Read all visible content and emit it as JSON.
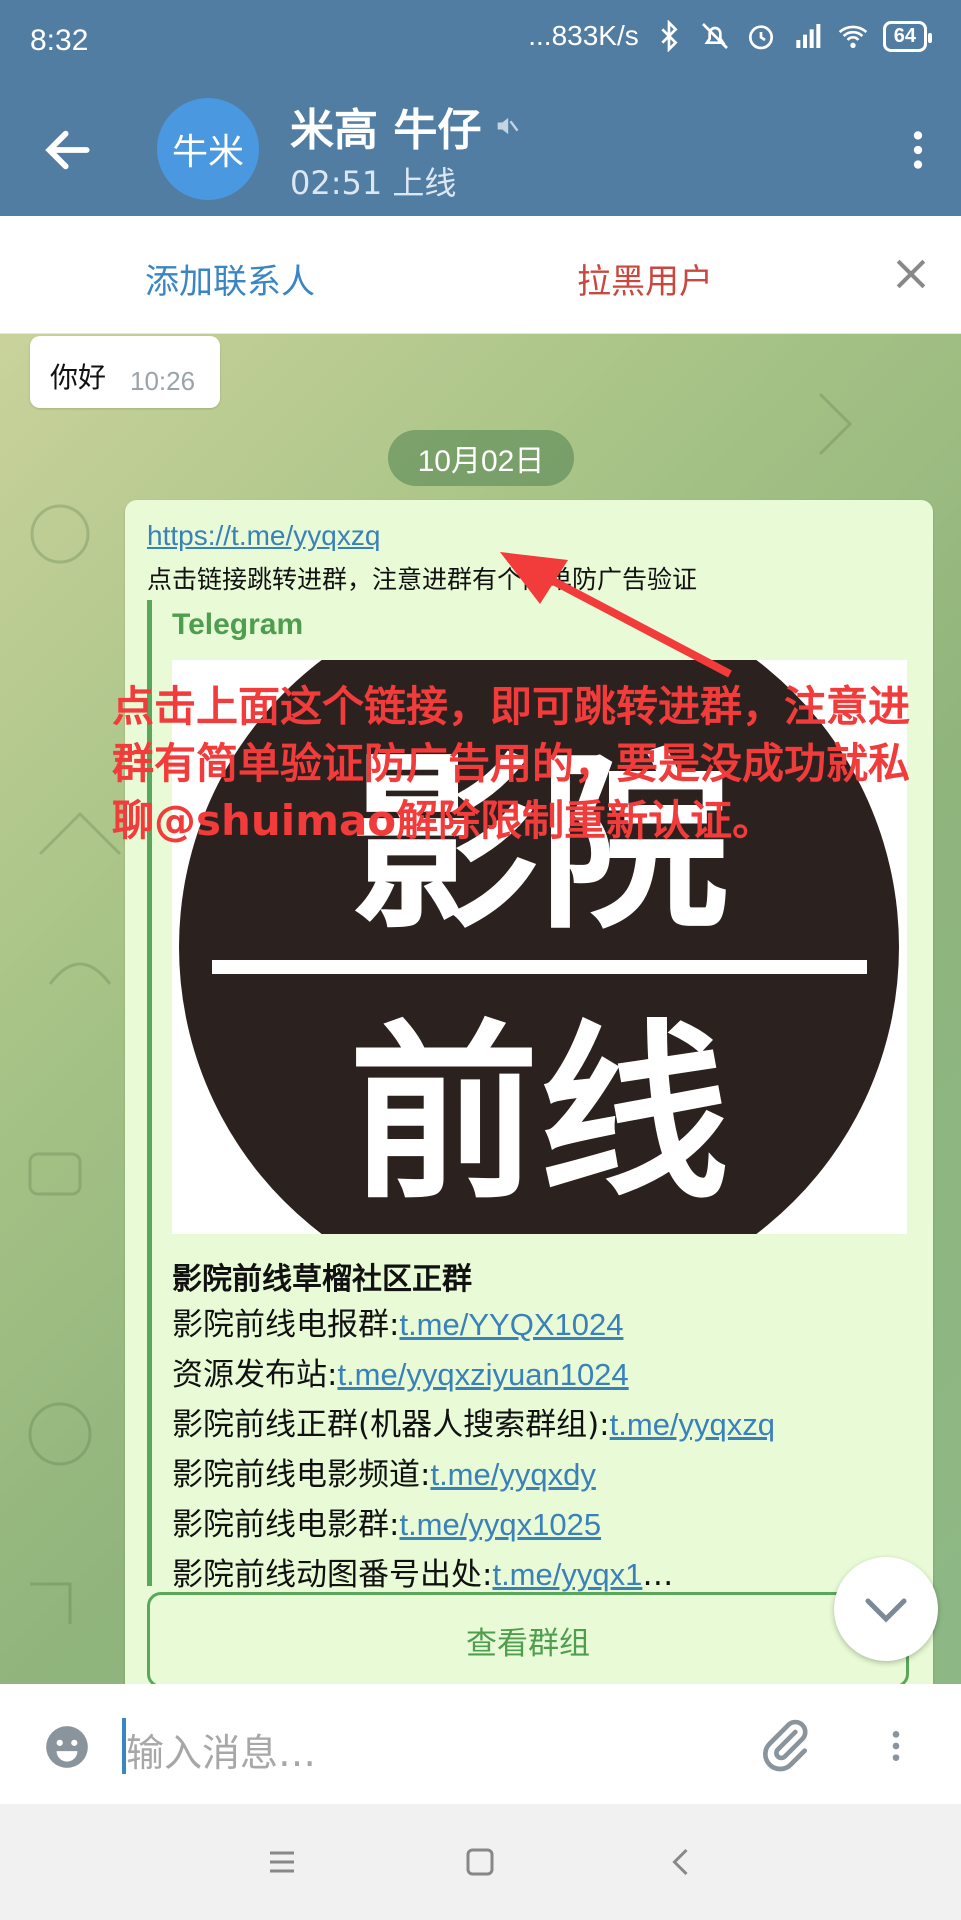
{
  "status_bar": {
    "time": "8:32",
    "net_speed": "...833K/s",
    "battery": "64",
    "icons": [
      "bluetooth-icon",
      "mute-icon",
      "alarm-icon",
      "hd-signal-icon",
      "wifi-icon",
      "battery-icon"
    ]
  },
  "header": {
    "avatar_text": "牛米",
    "title": "米高 牛仔",
    "subtitle": "02:51 上线",
    "colors": {
      "bar": "#527da3",
      "avatar": "#4a98e0"
    }
  },
  "action_bar": {
    "add_contact": "添加联系人",
    "block_user": "拉黑用户"
  },
  "messages": {
    "first": {
      "text": "你好",
      "time": "10:26"
    },
    "date_chip": "10月02日",
    "main": {
      "link": "https://t.me/yyqxzq",
      "note": "点击链接跳转进群，注意进群有个简单防广告验证",
      "preview": {
        "site": "Telegram",
        "title": "影院前线草榴社区正群",
        "image_text": "影院前线",
        "lines": [
          {
            "label": "影院前线电报群:",
            "link": "t.me/YYQX1024"
          },
          {
            "label": "资源发布站:",
            "link": "t.me/yyqxziyuan1024"
          },
          {
            "label": "影院前线正群(机器人搜索群组):",
            "link": "t.me/yyqxzq"
          },
          {
            "label": "影院前线电影频道:",
            "link": "t.me/yyqxdy"
          },
          {
            "label": "影院前线电影群:",
            "link": "t.me/yyqx1025"
          },
          {
            "label": "影院前线动图番号出处:",
            "link": "t.me/yyqx1",
            "suffix": "…"
          }
        ]
      },
      "view_group": "查看群组"
    }
  },
  "annotation": {
    "text": "点击上面这个链接，即可跳转进群，注意进群有简单验证防广告用的，要是没成功就私聊@shuimao解除限制重新认证。",
    "color": "#f23b3b"
  },
  "input": {
    "placeholder": "输入消息…"
  }
}
